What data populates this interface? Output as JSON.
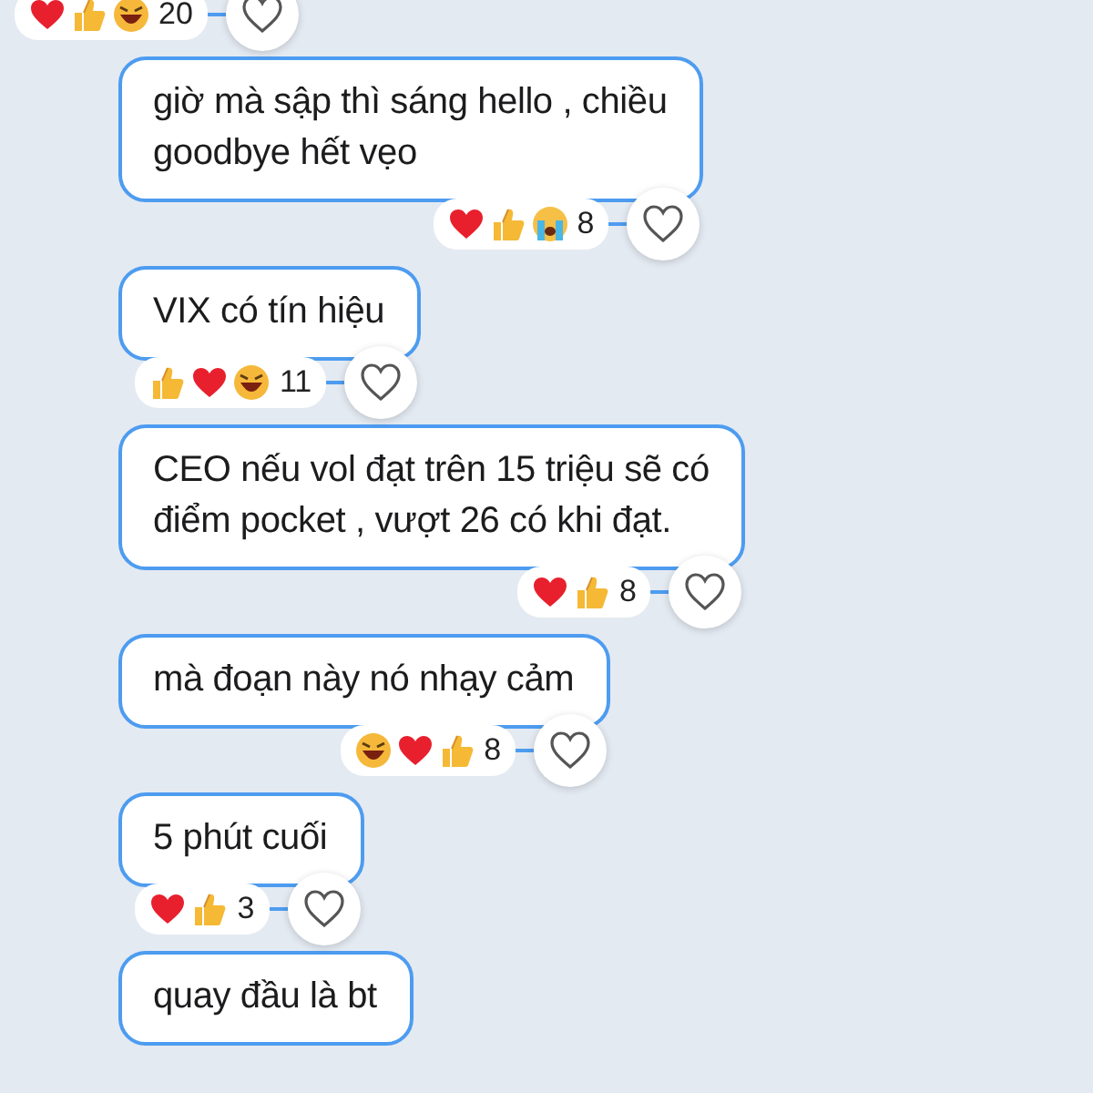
{
  "top_reactions": {
    "reactions": [
      {
        "kind": "heart"
      },
      {
        "kind": "like"
      },
      {
        "kind": "haha"
      }
    ],
    "count": "20"
  },
  "messages": [
    {
      "text": "giờ mà sập thì sáng hello , chiều\ngoodbye hết vẹo",
      "reactions": [
        {
          "kind": "heart"
        },
        {
          "kind": "like"
        },
        {
          "kind": "cry"
        }
      ],
      "count": "8"
    },
    {
      "text": "VIX có tín hiệu",
      "reactions": [
        {
          "kind": "like"
        },
        {
          "kind": "heart"
        },
        {
          "kind": "haha"
        }
      ],
      "count": "11"
    },
    {
      "text": "CEO nếu vol đạt trên 15 triệu sẽ có\nđiểm pocket , vượt 26 có khi đạt.",
      "reactions": [
        {
          "kind": "heart"
        },
        {
          "kind": "like"
        }
      ],
      "count": "8"
    },
    {
      "text": "mà đoạn này nó nhạy cảm",
      "reactions": [
        {
          "kind": "haha"
        },
        {
          "kind": "heart"
        },
        {
          "kind": "like"
        }
      ],
      "count": "8"
    },
    {
      "text": "5 phút cuối",
      "reactions": [
        {
          "kind": "heart"
        },
        {
          "kind": "like"
        }
      ],
      "count": "3"
    },
    {
      "text": "quay đầu là bt"
    }
  ]
}
